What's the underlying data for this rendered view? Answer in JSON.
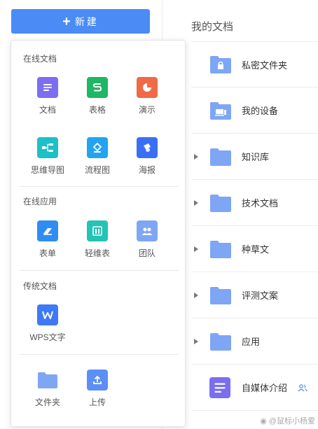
{
  "new_button": {
    "label": "新建",
    "icon": "plus-icon"
  },
  "dropdown": {
    "online_docs": {
      "title": "在线文档",
      "items": [
        {
          "label": "文档",
          "icon": "doc-icon",
          "color": "#7b6ef0"
        },
        {
          "label": "表格",
          "icon": "sheet-icon",
          "color": "#1fb665"
        },
        {
          "label": "演示",
          "icon": "slides-icon",
          "color": "#f06a48"
        },
        {
          "label": "思维导图",
          "icon": "mindmap-icon",
          "color": "#1cc0c8"
        },
        {
          "label": "流程图",
          "icon": "flowchart-icon",
          "color": "#23a4f0"
        },
        {
          "label": "海报",
          "icon": "poster-icon",
          "color": "#3a6ff5"
        }
      ]
    },
    "online_apps": {
      "title": "在线应用",
      "items": [
        {
          "label": "表单",
          "icon": "form-icon",
          "color": "#2f8cf2"
        },
        {
          "label": "轻维表",
          "icon": "light-table-icon",
          "color": "#23c3b6"
        },
        {
          "label": "团队",
          "icon": "team-icon",
          "color": "#7fa6f2"
        }
      ]
    },
    "traditional_docs": {
      "title": "传统文档",
      "items": [
        {
          "label": "WPS文字",
          "icon": "wps-writer-icon",
          "color": "#3e7af5"
        }
      ]
    },
    "other": {
      "items": [
        {
          "label": "文件夹",
          "icon": "folder-icon",
          "color": "#7ea6f5"
        },
        {
          "label": "上传",
          "icon": "upload-icon",
          "color": "#5b8ff5"
        }
      ]
    }
  },
  "my_docs": {
    "title": "我的文档",
    "rows": [
      {
        "label": "私密文件夹",
        "icon": "private-folder-icon",
        "expandable": false
      },
      {
        "label": "我的设备",
        "icon": "device-folder-icon",
        "expandable": false
      },
      {
        "label": "知识库",
        "icon": "folder-icon",
        "expandable": true
      },
      {
        "label": "技术文档",
        "icon": "folder-icon",
        "expandable": true
      },
      {
        "label": "种草文",
        "icon": "folder-icon",
        "expandable": true
      },
      {
        "label": "评测文案",
        "icon": "folder-icon",
        "expandable": true
      },
      {
        "label": "应用",
        "icon": "folder-icon",
        "expandable": true
      },
      {
        "label": "自媒体介绍",
        "icon": "doc-icon",
        "expandable": false,
        "shared": true
      }
    ]
  },
  "watermark": "@鼠标小杨爱"
}
